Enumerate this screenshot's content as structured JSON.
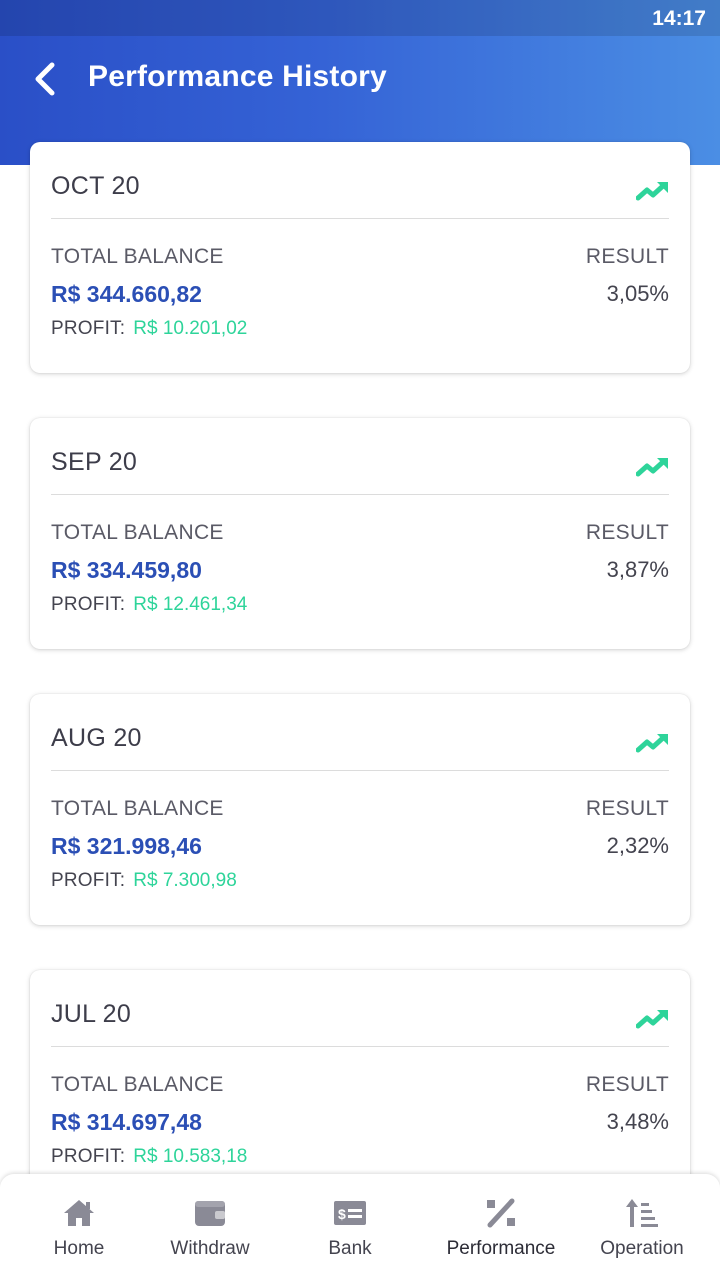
{
  "status_bar": {
    "time": "14:17"
  },
  "header": {
    "title": "Performance History",
    "back_icon": "chevron-left-icon"
  },
  "colors": {
    "header_gradient_start": "#2a4fc7",
    "header_gradient_end": "#4b8ee4",
    "balance_blue": "#2b4fb5",
    "profit_green": "#2ed49a",
    "trend_green": "#2ed49a"
  },
  "cards": [
    {
      "month": "OCT 20",
      "total_balance_label": "TOTAL BALANCE",
      "result_label": "RESULT",
      "balance": "R$ 344.660,82",
      "result": "3,05%",
      "profit_label": "PROFIT:",
      "profit": "R$ 10.201,02",
      "trend_icon": "trending-up-icon"
    },
    {
      "month": "SEP 20",
      "total_balance_label": "TOTAL BALANCE",
      "result_label": "RESULT",
      "balance": "R$ 334.459,80",
      "result": "3,87%",
      "profit_label": "PROFIT:",
      "profit": "R$ 12.461,34",
      "trend_icon": "trending-up-icon"
    },
    {
      "month": "AUG 20",
      "total_balance_label": "TOTAL BALANCE",
      "result_label": "RESULT",
      "balance": "R$ 321.998,46",
      "result": "2,32%",
      "profit_label": "PROFIT:",
      "profit": "R$ 7.300,98",
      "trend_icon": "trending-up-icon"
    },
    {
      "month": "JUL 20",
      "total_balance_label": "TOTAL BALANCE",
      "result_label": "RESULT",
      "balance": "R$ 314.697,48",
      "result": "3,48%",
      "profit_label": "PROFIT:",
      "profit": "R$ 10.583,18",
      "trend_icon": "trending-up-icon"
    }
  ],
  "bottom_nav": {
    "active": "Performance",
    "items": [
      {
        "label": "Home",
        "icon": "home-icon"
      },
      {
        "label": "Withdraw",
        "icon": "wallet-icon"
      },
      {
        "label": "Bank",
        "icon": "bank-check-icon"
      },
      {
        "label": "Performance",
        "icon": "percent-icon"
      },
      {
        "label": "Operation",
        "icon": "sort-ascending-icon"
      }
    ]
  }
}
